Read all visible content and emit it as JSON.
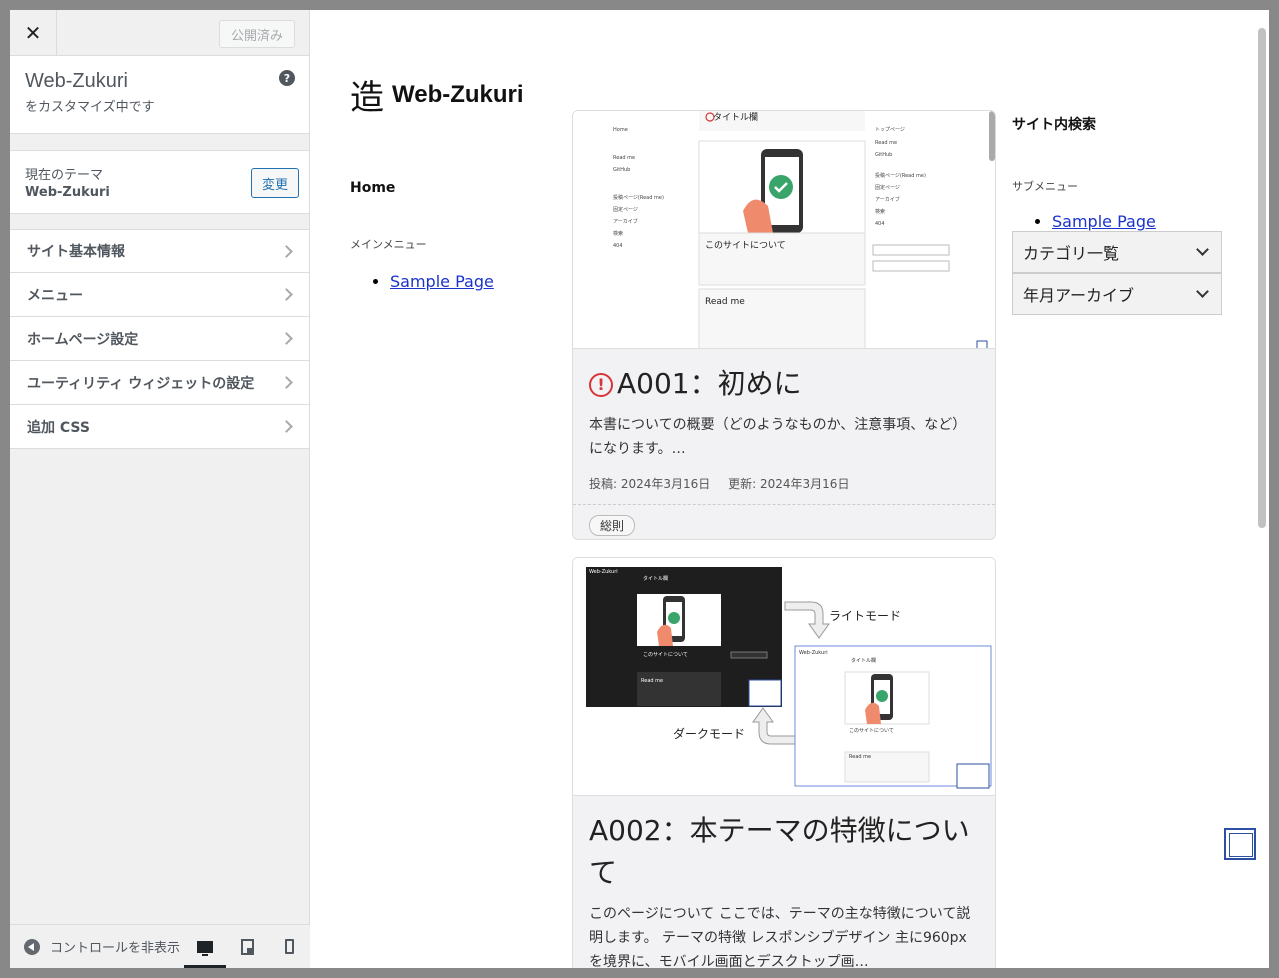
{
  "customizer": {
    "close_label": "✕",
    "publish_label": "公開済み",
    "site_name": "Web-Zukuri",
    "customizing_label": "をカスタマイズ中です",
    "help_label": "?",
    "theme_label": "現在のテーマ",
    "theme_name": "Web-Zukuri",
    "change_label": "変更",
    "menu": [
      {
        "label": "サイト基本情報"
      },
      {
        "label": "メニュー"
      },
      {
        "label": "ホームページ設定"
      },
      {
        "label": "ユーティリティ ウィジェットの設定"
      },
      {
        "label": "追加 CSS"
      }
    ],
    "collapse_label": "コントロールを非表示",
    "devices": [
      "desktop",
      "tablet",
      "mobile"
    ]
  },
  "preview": {
    "logo_mark": "造",
    "site_title": "Web-Zukuri",
    "home_label": "Home",
    "main_menu_heading": "メインメニュー",
    "main_menu_items": [
      "Sample Page"
    ],
    "search_heading": "サイト内検索",
    "submenu_heading": "サブメニュー",
    "submenu_items": [
      "Sample Page"
    ],
    "dropdowns": [
      "カテゴリ一覧",
      "年月アーカイブ"
    ],
    "posts": [
      {
        "title": "A001：初めに",
        "excerpt": "本書についての概要（どのようなものか、注意事項、など）になります。…",
        "posted": "投稿: 2024年3月16日",
        "updated": "更新: 2024年3月16日",
        "tag": "総則",
        "thumb_labels": [
          "タイトル欄",
          "このサイトについて",
          "Read me"
        ]
      },
      {
        "title": "A002：本テーマの特徴について",
        "excerpt": "このページについて ここでは、テーマの主な特徴について説明します。 テーマの特徴 レスポンシブデザイン 主に960px を境界に、モバイル画面とデスクトップ画…",
        "thumb_labels": [
          "ライトモード",
          "ダークモード"
        ]
      }
    ]
  },
  "colors": {
    "accent": "#2271b1",
    "link": "#1a33cc",
    "warning": "#d63638",
    "check_green": "#3aa56a"
  }
}
